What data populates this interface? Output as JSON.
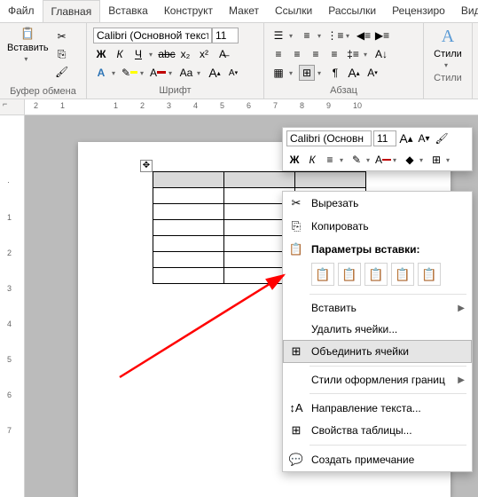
{
  "tabs": [
    "Файл",
    "Главная",
    "Вставка",
    "Конструкт",
    "Макет",
    "Ссылки",
    "Рассылки",
    "Рецензиро",
    "Вид"
  ],
  "active_tab": 1,
  "clipboard": {
    "paste": "Вставить",
    "label": "Буфер обмена"
  },
  "font": {
    "name": "Calibri (Основной текст",
    "size": "11",
    "bold": "Ж",
    "italic": "К",
    "underline": "Ч",
    "strike": "abc",
    "sub": "x₂",
    "sup": "x²",
    "label": "Шрифт"
  },
  "para": {
    "label": "Абзац"
  },
  "styles": {
    "label": "Стили",
    "btn": "Стили"
  },
  "mini": {
    "font": "Calibri (Основн",
    "size": "11"
  },
  "ctx": {
    "cut": "Вырезать",
    "copy": "Копировать",
    "paste_hdr": "Параметры вставки:",
    "insert": "Вставить",
    "delete": "Удалить ячейки...",
    "merge": "Объединить ячейки",
    "border_styles": "Стили оформления границ",
    "text_dir": "Направление текста...",
    "tbl_props": "Свойства таблицы...",
    "new_comment": "Создать примечание"
  },
  "ruler": [
    "1",
    "2",
    "1",
    "2",
    "3",
    "4",
    "5",
    "6",
    "7",
    "8",
    "9",
    "10"
  ]
}
